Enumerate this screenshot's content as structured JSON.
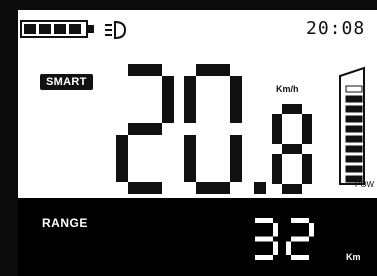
{
  "status_bar": {
    "battery_bars": 4,
    "battery_icon": "battery-icon",
    "headlight_icon": "headlight-icon",
    "time": "20:08"
  },
  "mode": {
    "label": "SMART"
  },
  "speed": {
    "value": "20.8",
    "unit": "Km/h"
  },
  "power": {
    "label": "POW",
    "level_fraction": 0.86
  },
  "range": {
    "label": "RANGE",
    "value": "32",
    "unit": "Km"
  },
  "colors": {
    "panel": "#ffffff",
    "lcd": "#111111",
    "background": "#000000"
  }
}
